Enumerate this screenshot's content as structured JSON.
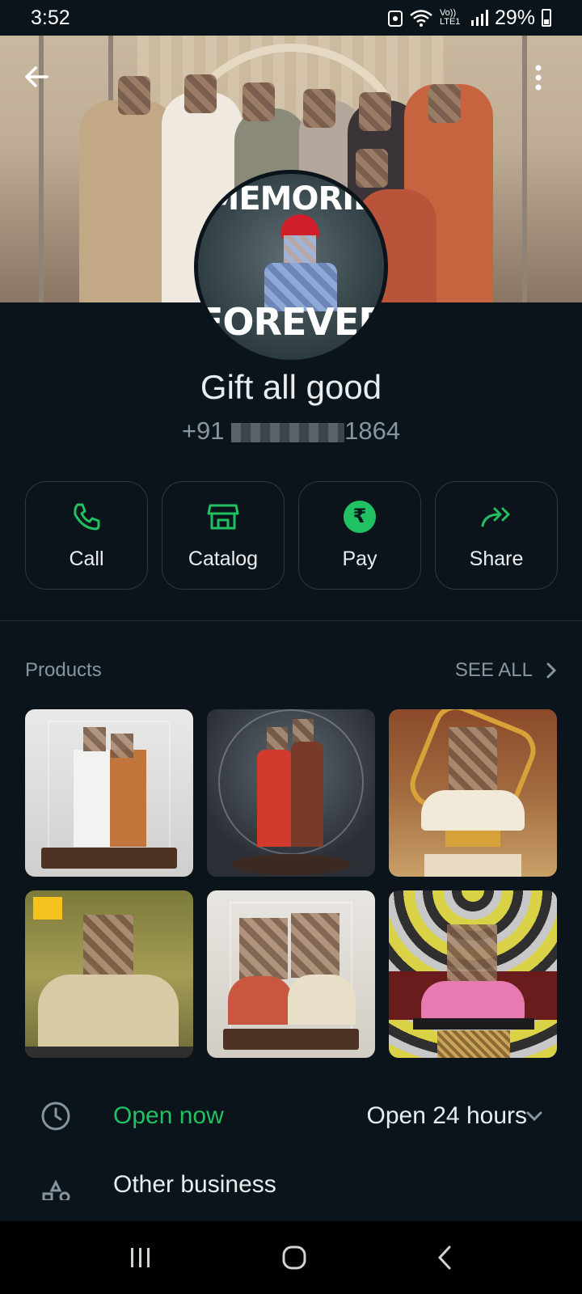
{
  "status_bar": {
    "time": "3:52",
    "network": "Vo)) LTE1",
    "battery": "29%"
  },
  "profile": {
    "name": "Gift all good",
    "phone_prefix": "+91",
    "phone_suffix": "1864",
    "avatar_top_text": "MEMORIE",
    "avatar_bottom_text": "FOREVER"
  },
  "actions": [
    {
      "label": "Call",
      "icon": "phone-icon"
    },
    {
      "label": "Catalog",
      "icon": "store-icon"
    },
    {
      "label": "Pay",
      "icon": "rupee-icon"
    },
    {
      "label": "Share",
      "icon": "share-arrow-icon"
    }
  ],
  "products": {
    "title": "Products",
    "see_all": "SEE ALL"
  },
  "hours": {
    "status": "Open now",
    "schedule": "Open 24 hours"
  },
  "other": {
    "label": "Other business"
  },
  "colors": {
    "background": "#0b141a",
    "accent": "#21c063",
    "muted": "#8696a0"
  }
}
